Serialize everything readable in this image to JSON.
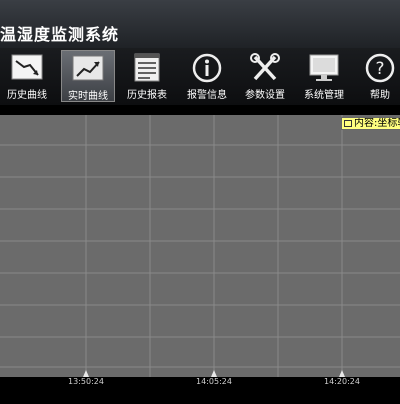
{
  "app": {
    "title": "温湿度监测系统"
  },
  "toolbar": {
    "items": [
      {
        "key": "history-curve",
        "label": "历史曲线",
        "icon": "line-chart-icon",
        "active": false
      },
      {
        "key": "realtime-curve",
        "label": "实时曲线",
        "icon": "trend-chart-icon",
        "active": true
      },
      {
        "key": "history-report",
        "label": "历史报表",
        "icon": "report-icon",
        "active": false
      },
      {
        "key": "alarm-info",
        "label": "报警信息",
        "icon": "info-icon",
        "active": false
      },
      {
        "key": "param-settings",
        "label": "参数设置",
        "icon": "tools-icon",
        "active": false
      },
      {
        "key": "system-management",
        "label": "系统管理",
        "icon": "monitor-icon",
        "active": false
      },
      {
        "key": "help",
        "label": "帮助",
        "icon": "help-icon",
        "active": false
      }
    ]
  },
  "legend": {
    "label": "内容:坐标轴"
  },
  "chart_data": {
    "type": "line",
    "x_ticks": [
      "13:50:24",
      "14:05:24",
      "14:20:24"
    ],
    "series": [],
    "grid": true
  },
  "colors": {
    "plot_bg": "#6b6b6b",
    "grid": "#8a8a8a",
    "legend_bg": "#ffff80"
  }
}
